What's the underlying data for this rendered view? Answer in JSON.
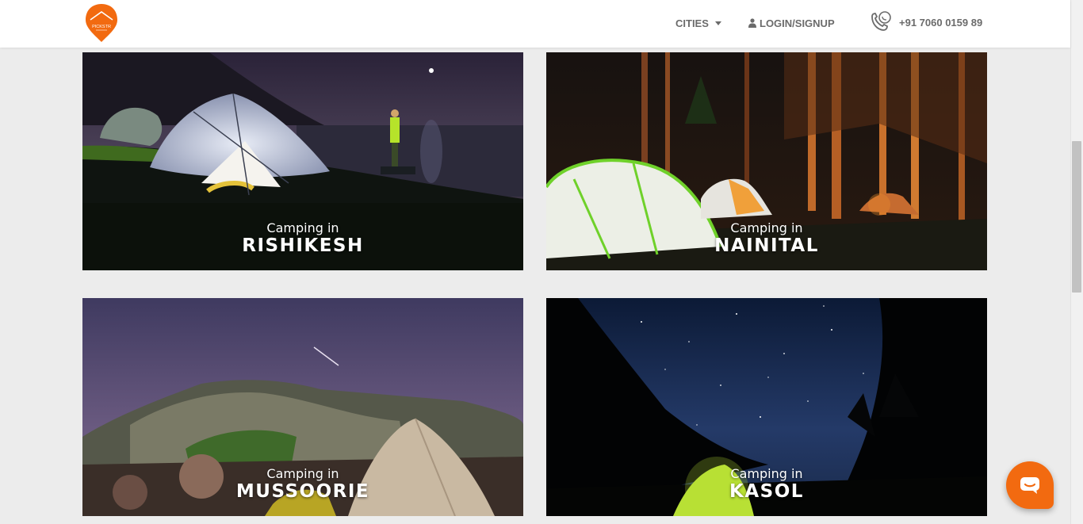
{
  "brand": {
    "logo_text": "PICKSTR",
    "accent": "#f26a10"
  },
  "nav": {
    "cities_label": "CITIES",
    "login_label": "LOGIN/SIGNUP",
    "phone": "+91 7060 0159 89",
    "icons": [
      "chevron-down-icon",
      "user-icon",
      "whatsapp-phone-icon"
    ]
  },
  "cards": [
    {
      "prefix": "Camping in",
      "city": "RISHIKESH"
    },
    {
      "prefix": "Camping in",
      "city": "NAINITAL"
    },
    {
      "prefix": "Camping in",
      "city": "MUSSOORIE"
    },
    {
      "prefix": "Camping in",
      "city": "KASOL"
    }
  ],
  "chat": {
    "icon": "chat-icon",
    "color": "#f26a10"
  }
}
